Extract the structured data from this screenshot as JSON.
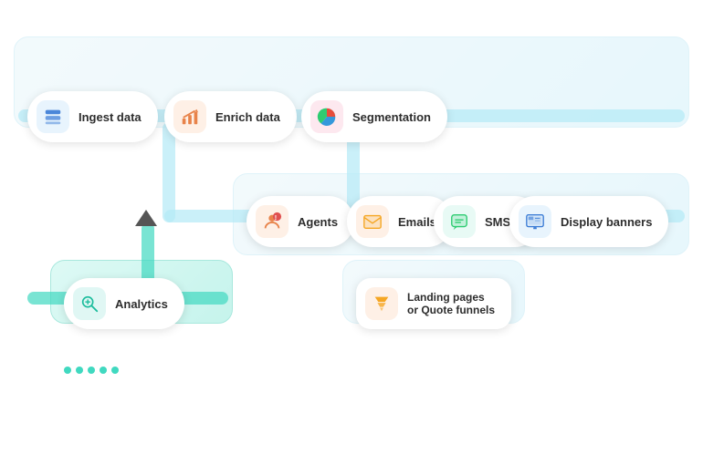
{
  "cards": {
    "ingest": {
      "label": "Ingest data",
      "icon": "🗄️",
      "icon_bg": "bg-blue"
    },
    "enrich": {
      "label": "Enrich data",
      "icon": "📊",
      "icon_bg": "bg-orange"
    },
    "segmentation": {
      "label": "Segmentation",
      "icon": "🥧",
      "icon_bg": "bg-pink"
    },
    "agents": {
      "label": "Agents",
      "icon": "👤",
      "icon_bg": "bg-orange"
    },
    "emails": {
      "label": "Emails",
      "icon": "✉️",
      "icon_bg": "bg-orange"
    },
    "smses": {
      "label": "SMSes",
      "icon": "💬",
      "icon_bg": "bg-green"
    },
    "display": {
      "label": "Display banners",
      "icon": "🖼️",
      "icon_bg": "bg-blue"
    },
    "analytics": {
      "label": "Analytics",
      "icon": "🔍",
      "icon_bg": "bg-teal"
    },
    "landing": {
      "label": "Landing pages\nor Quote funnels",
      "icon": "📥",
      "icon_bg": "bg-orange"
    }
  },
  "dots": [
    1,
    2,
    3,
    4,
    5
  ]
}
